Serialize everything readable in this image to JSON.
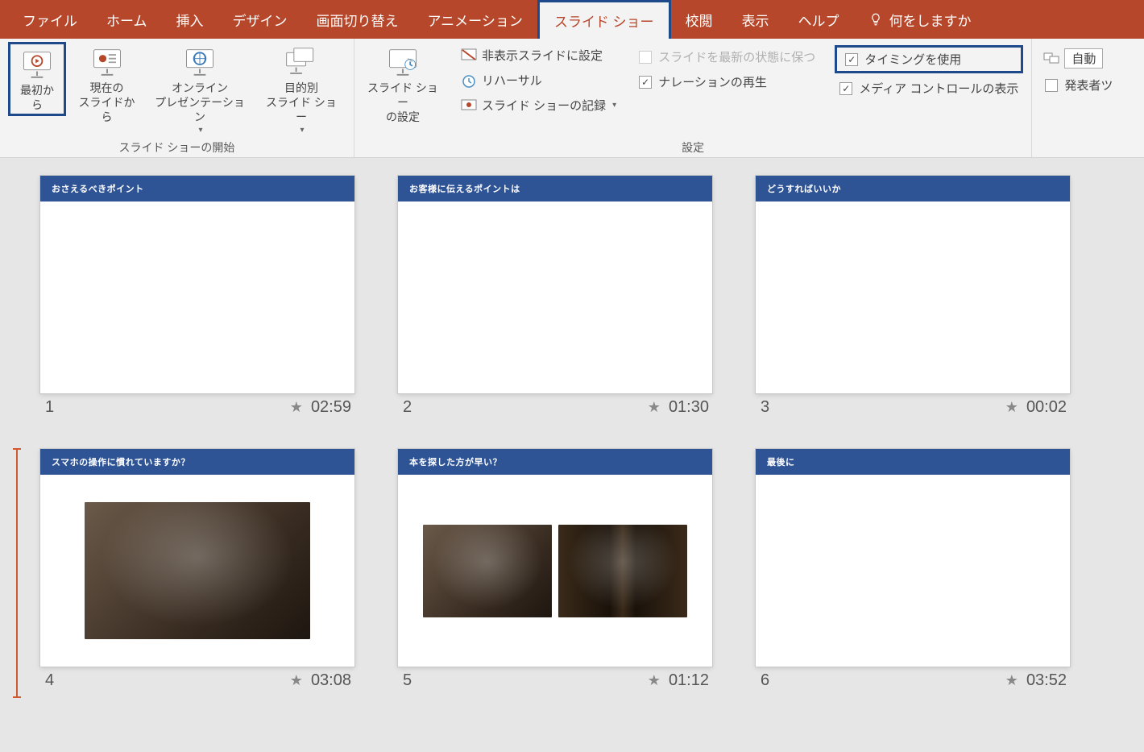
{
  "menu": {
    "tabs": [
      "ファイル",
      "ホーム",
      "挿入",
      "デザイン",
      "画面切り替え",
      "アニメーション",
      "スライド ショー",
      "校閲",
      "表示",
      "ヘルプ"
    ],
    "active_index": 6,
    "tell_me": "何をしますか"
  },
  "ribbon": {
    "group_start": {
      "label": "スライド ショーの開始",
      "from_beginning": "最初から",
      "from_current": "現在の\nスライドから",
      "online": "オンライン\nプレゼンテーション",
      "custom": "目的別\nスライド ショー"
    },
    "group_setup": {
      "label": "設定",
      "setup": "スライド ショー\nの設定",
      "hide": "非表示スライドに設定",
      "rehearse": "リハーサル",
      "record": "スライド ショーの記録",
      "keep_updated": "スライドを最新の状態に保つ",
      "narration": "ナレーションの再生",
      "timings": "タイミングを使用",
      "media_controls": "メディア コントロールの表示"
    },
    "group_monitor": {
      "auto": "自動",
      "presenter": "発表者ツ"
    }
  },
  "slides": [
    {
      "title": "おさえるべきポイント",
      "number": "1",
      "time": "02:59",
      "images": 0
    },
    {
      "title": "お客様に伝えるポイントは",
      "number": "2",
      "time": "01:30",
      "images": 0
    },
    {
      "title": "どうすればいいか",
      "number": "3",
      "time": "00:02",
      "images": 0
    },
    {
      "title": "スマホの操作に慣れていますか？",
      "number": "4",
      "time": "03:08",
      "images": 1
    },
    {
      "title": "本を探した方が早い？",
      "number": "5",
      "time": "01:12",
      "images": 2
    },
    {
      "title": "最後に",
      "number": "6",
      "time": "03:52",
      "images": 0
    }
  ]
}
